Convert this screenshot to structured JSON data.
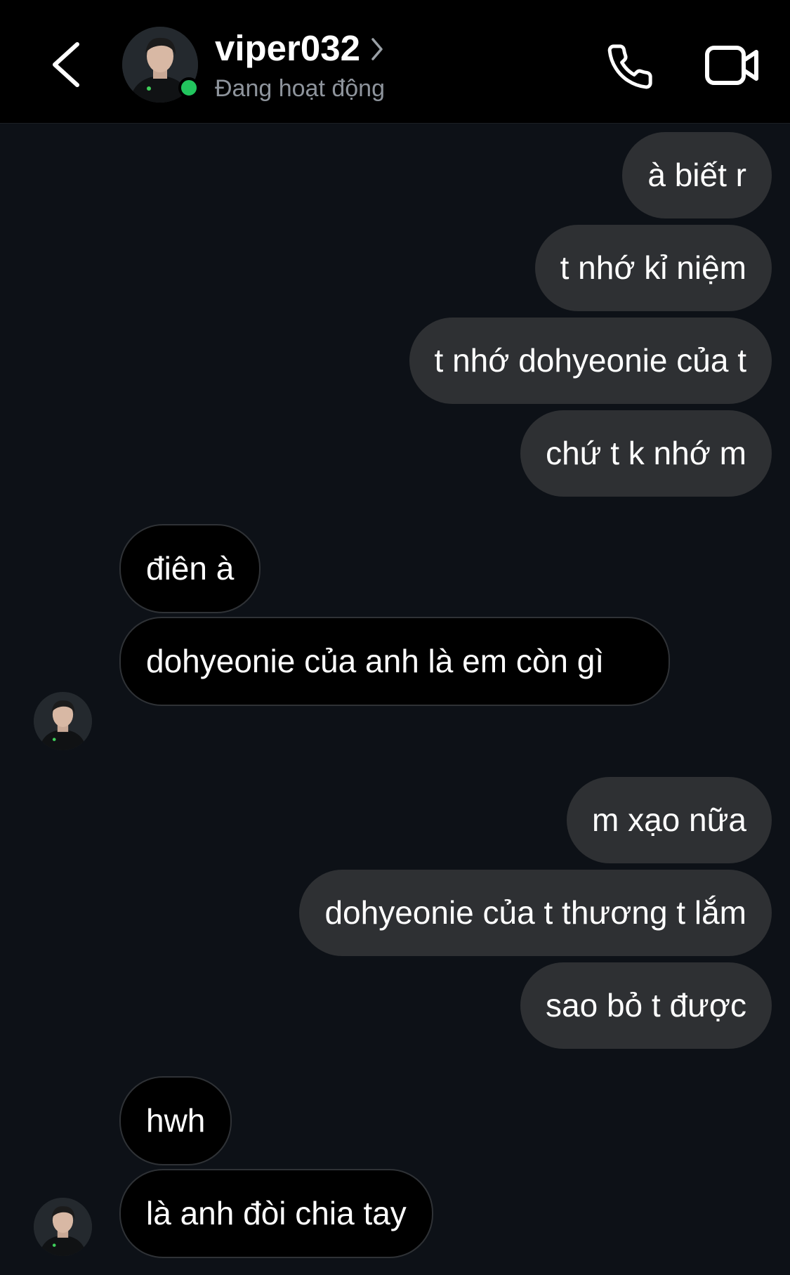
{
  "header": {
    "username": "viper032",
    "status": "Đang hoạt động"
  },
  "messages": [
    {
      "side": "out",
      "text": "à biết r"
    },
    {
      "side": "out",
      "text": "t nhớ kỉ niệm"
    },
    {
      "side": "out",
      "text": "t nhớ dohyeonie của t"
    },
    {
      "side": "out",
      "text": "chứ t k nhớ m"
    },
    {
      "side": "in",
      "text": "điên à"
    },
    {
      "side": "in",
      "text": "dohyeonie của anh là em còn gì"
    },
    {
      "side": "out",
      "text": "m xạo nữa"
    },
    {
      "side": "out",
      "text": "dohyeonie của t thương t lắm"
    },
    {
      "side": "out",
      "text": "sao bỏ t được"
    },
    {
      "side": "in",
      "text": "hwh"
    },
    {
      "side": "in",
      "text": "là anh đòi chia tay"
    }
  ],
  "colors": {
    "background": "#0d1117",
    "outgoing_bubble": "#2e3033",
    "incoming_bubble": "#000000",
    "online": "#22c55e"
  },
  "icons": {
    "back": "chevron-left-icon",
    "profile_chevron": "chevron-right-icon",
    "call": "phone-icon",
    "video": "video-camera-icon"
  }
}
